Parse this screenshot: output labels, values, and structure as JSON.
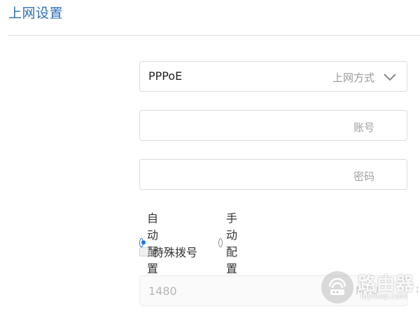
{
  "header": {
    "title": "上网设置"
  },
  "form": {
    "connection_type": {
      "value": "PPPoE",
      "label": "上网方式",
      "icon": "chevron-down-icon"
    },
    "account": {
      "placeholder": "账号",
      "value": ""
    },
    "password": {
      "placeholder": "密码",
      "value": ""
    },
    "config_mode": {
      "options": [
        {
          "label": "自动配置",
          "selected": true
        },
        {
          "label": "手动配置",
          "selected": false
        }
      ]
    },
    "special_dial": {
      "label": "特殊拨号",
      "checked": false
    },
    "mtu": {
      "value": "1480",
      "unit": "MTU"
    }
  },
  "edge_text": ":",
  "watermark": {
    "text": "路由器",
    "subtext": "luyouqi.com"
  },
  "colors": {
    "accent": "#1a73e8",
    "title": "#2d6fb7"
  }
}
